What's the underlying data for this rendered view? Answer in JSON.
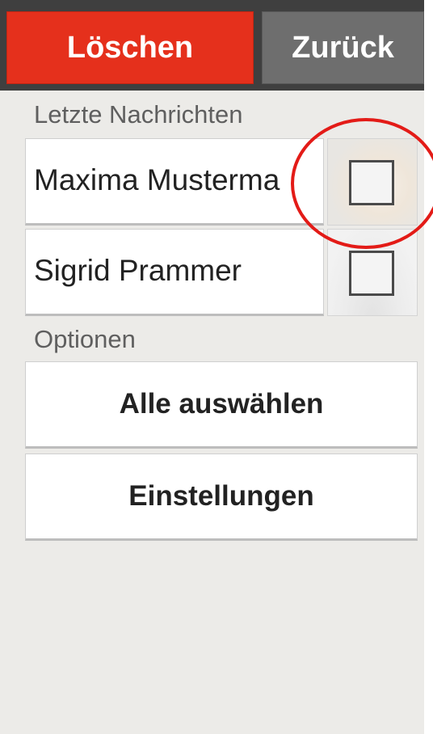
{
  "header": {
    "delete_label": "Löschen",
    "back_label": "Zurück"
  },
  "recent": {
    "section_label": "Letzte Nachrichten",
    "contacts": [
      {
        "name": "Maxima Musterma",
        "selected": false,
        "avatar": "photo"
      },
      {
        "name": "Sigrid Prammer",
        "selected": false,
        "avatar": "placeholder-silhouette"
      }
    ]
  },
  "options": {
    "section_label": "Optionen",
    "select_all_label": "Alle auswählen",
    "settings_label": "Einstellungen"
  },
  "colors": {
    "delete_button": "#e5301c",
    "back_button": "#6e6e6e",
    "top_bar": "#3f3f3f",
    "background": "#ecebe8",
    "highlight_circle": "#e31b17"
  }
}
